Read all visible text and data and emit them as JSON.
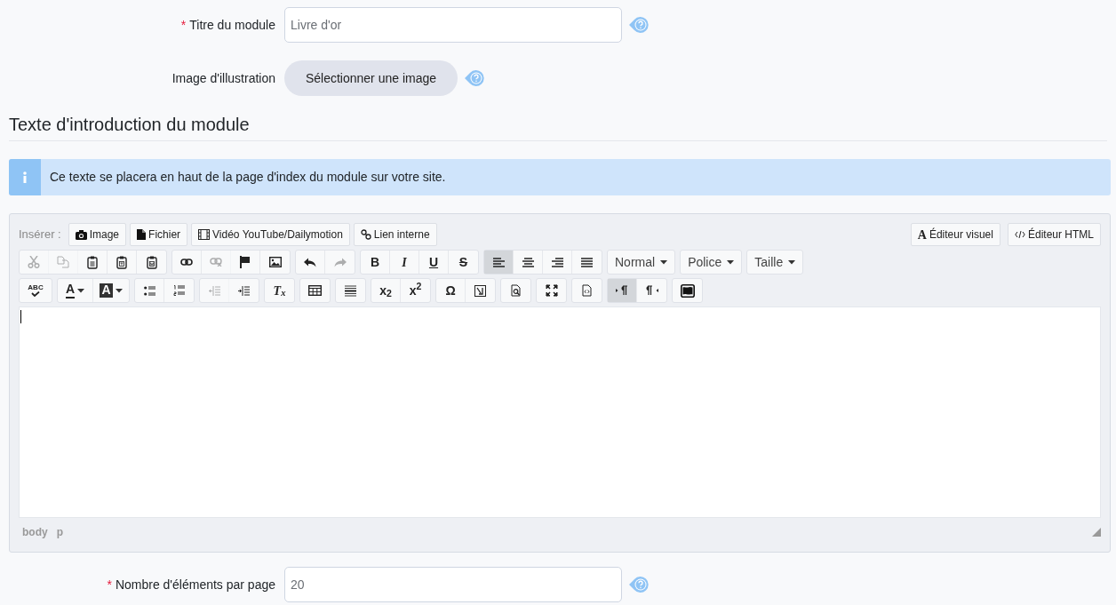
{
  "fields_top": [
    {
      "marker": "*",
      "label": "Titre du module",
      "kind": "input",
      "value": "Livre d'or"
    },
    {
      "label": "Image d'illustration",
      "kind": "button",
      "value": "Sélectionner une image"
    }
  ],
  "section": {
    "title": "Texte d'introduction du module",
    "info": "Ce texte se placera en haut de la page d'index du module sur votre site."
  },
  "editor": {
    "insert_label": "Insérer :",
    "insert_buttons": [
      {
        "kind": "camera",
        "label": "Image"
      },
      {
        "kind": "file",
        "label": "Fichier"
      },
      {
        "kind": "film",
        "label": "Vidéo YouTube/Dailymotion"
      },
      {
        "kind": "link",
        "label": "Lien interne"
      }
    ],
    "mode_buttons": [
      {
        "kind": "visual",
        "glyph": "A",
        "label": "Éditeur visuel",
        "selected": false
      },
      {
        "kind": "code",
        "label": "Éditeur HTML",
        "selected": false
      }
    ],
    "toolbar_rows": [
      [
        [
          {
            "kind": "cut",
            "disabled": true,
            "selected": false
          },
          {
            "kind": "copy",
            "disabled": true,
            "selected": false
          },
          {
            "kind": "paste",
            "disabled": false,
            "selected": false
          },
          {
            "kind": "paste-text",
            "disabled": false,
            "selected": false
          },
          {
            "kind": "paste-word",
            "disabled": false,
            "selected": false
          }
        ],
        [
          {
            "kind": "link",
            "disabled": false,
            "selected": false
          },
          {
            "kind": "unlink",
            "disabled": true,
            "selected": false
          },
          {
            "kind": "anchor",
            "disabled": false,
            "selected": false
          },
          {
            "kind": "image",
            "disabled": false,
            "selected": false
          }
        ],
        [
          {
            "kind": "undo",
            "disabled": false,
            "selected": false
          },
          {
            "kind": "redo",
            "disabled": true,
            "selected": false
          }
        ],
        [
          {
            "kind": "bold",
            "label": "B",
            "disabled": false,
            "selected": false
          },
          {
            "kind": "italic",
            "label": "I",
            "disabled": false,
            "selected": false
          },
          {
            "kind": "underline",
            "label": "U",
            "disabled": false,
            "selected": false
          },
          {
            "kind": "strike",
            "label": "S",
            "disabled": false,
            "selected": false
          }
        ],
        [
          {
            "kind": "align-left",
            "disabled": false,
            "selected": true
          },
          {
            "kind": "align-center",
            "disabled": false,
            "selected": false
          },
          {
            "kind": "align-right",
            "disabled": false,
            "selected": false
          },
          {
            "kind": "justify",
            "disabled": false,
            "selected": false
          }
        ],
        [
          {
            "kind": "dropdown",
            "label": "Normal",
            "disabled": false,
            "selected": false
          }
        ],
        [
          {
            "kind": "dropdown",
            "label": "Police",
            "disabled": false,
            "selected": false
          }
        ],
        [
          {
            "kind": "dropdown",
            "label": "Taille",
            "disabled": false,
            "selected": false
          }
        ]
      ],
      [
        [
          {
            "kind": "spellcheck",
            "label": "ABC",
            "disabled": false,
            "selected": false
          }
        ],
        [
          {
            "kind": "color",
            "label": "A",
            "disabled": false,
            "selected": false
          },
          {
            "kind": "bgcolor",
            "label": "A",
            "disabled": false,
            "selected": false
          }
        ],
        [
          {
            "kind": "bullets",
            "disabled": false,
            "selected": false
          },
          {
            "kind": "numbers",
            "disabled": false,
            "selected": false
          }
        ],
        [
          {
            "kind": "outdent",
            "disabled": true,
            "selected": false
          },
          {
            "kind": "indent",
            "disabled": false,
            "selected": false
          }
        ],
        [
          {
            "kind": "italic",
            "label": "T$_{x}$",
            "disabled": false,
            "selected": false
          }
        ],
        [
          {
            "kind": "table",
            "disabled": false,
            "selected": false
          }
        ],
        [
          {
            "kind": "hr",
            "disabled": false,
            "selected": false
          }
        ],
        [
          {
            "kind": "bold",
            "label": "x$_{2}$",
            "disabled": false,
            "selected": false
          },
          {
            "kind": "bold",
            "label": "x$^{2}$",
            "disabled": false,
            "selected": false
          }
        ],
        [
          {
            "kind": "bold",
            "label": "Ω",
            "disabled": false,
            "selected": false
          },
          {
            "kind": "template",
            "disabled": false,
            "selected": false
          }
        ],
        [
          {
            "kind": "preview",
            "disabled": false,
            "selected": false
          }
        ],
        [
          {
            "kind": "maximize",
            "disabled": false,
            "selected": false
          }
        ],
        [
          {
            "kind": "source",
            "disabled": false,
            "selected": false
          }
        ],
        [
          {
            "kind": "ltr",
            "disabled": false,
            "selected": true
          },
          {
            "kind": "rtl",
            "disabled": false,
            "selected": false
          }
        ],
        [
          {
            "kind": "frame",
            "disabled": false,
            "selected": false
          }
        ]
      ]
    ],
    "path": [
      "body",
      "p"
    ]
  },
  "fields_bottom": [
    {
      "marker": "*",
      "label": "Nombre d'éléments par page",
      "kind": "input",
      "value": "20"
    }
  ]
}
